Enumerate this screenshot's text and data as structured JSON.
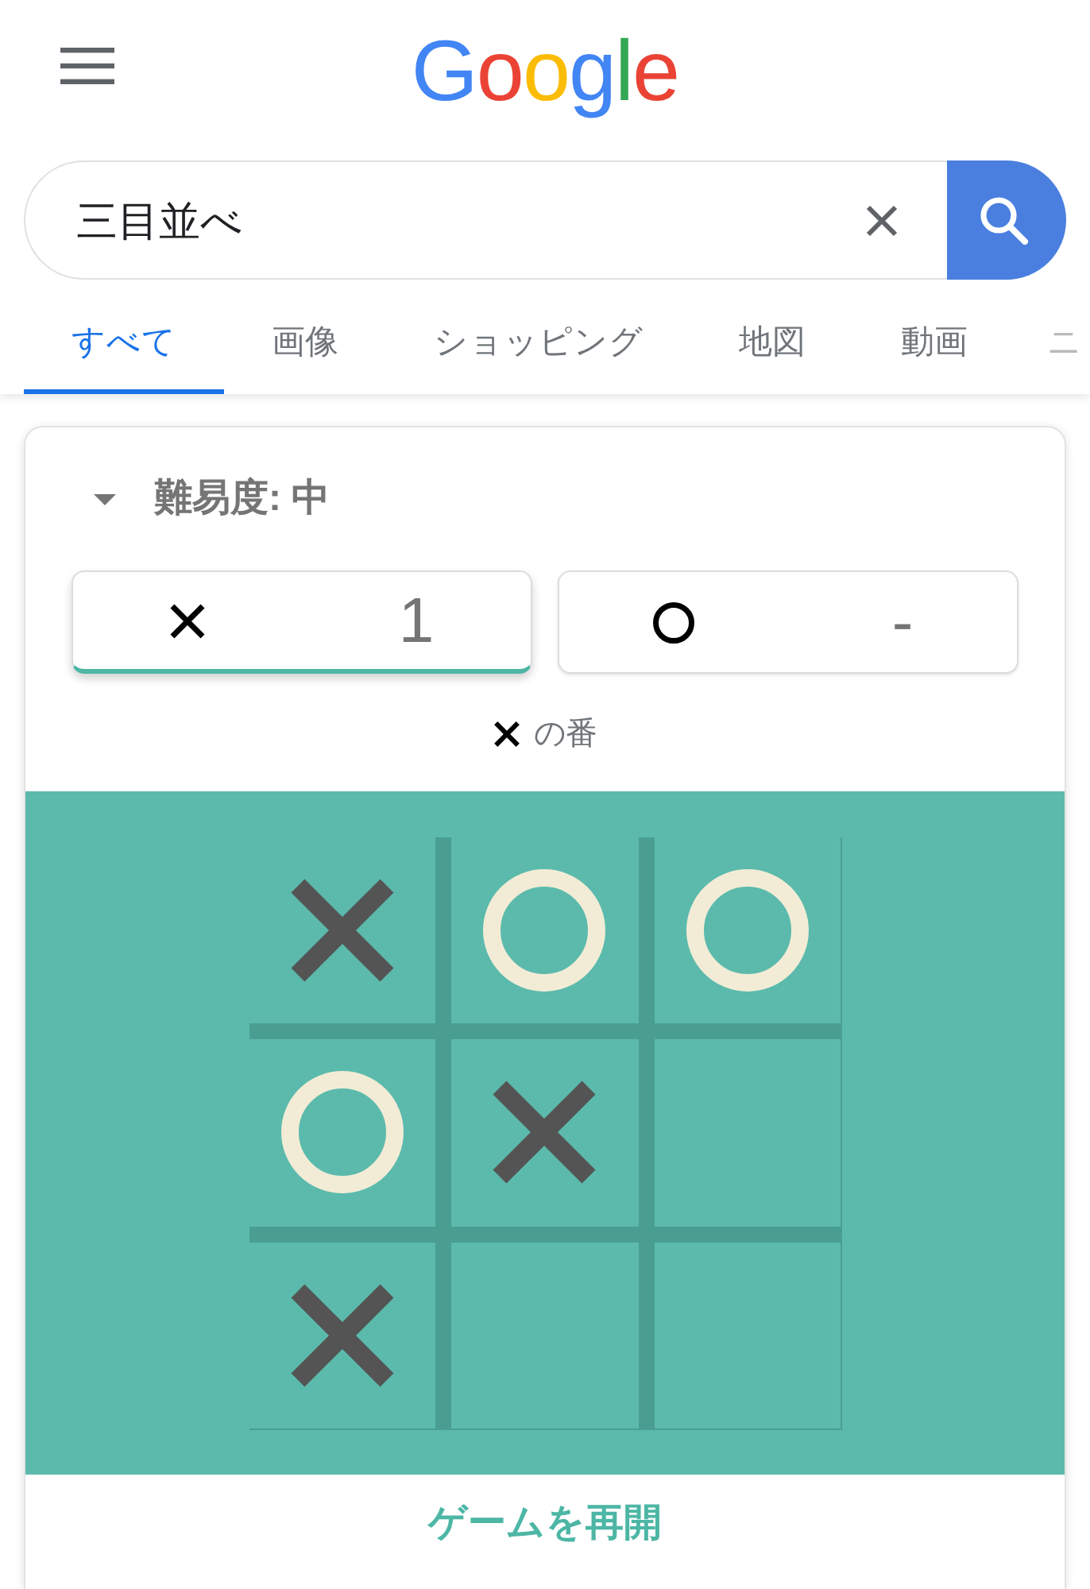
{
  "header": {
    "logo": "Google"
  },
  "search": {
    "value": "三目並べ"
  },
  "tabs": [
    {
      "label": "すべて",
      "selected": true
    },
    {
      "label": "画像",
      "selected": false
    },
    {
      "label": "ショッピング",
      "selected": false
    },
    {
      "label": "地図",
      "selected": false
    },
    {
      "label": "動画",
      "selected": false
    },
    {
      "label": "ニ",
      "selected": false
    }
  ],
  "game": {
    "difficulty": "難易度: 中",
    "players": [
      {
        "kind": "x",
        "score": "1",
        "selected": true
      },
      {
        "kind": "o",
        "score": "-",
        "selected": false
      }
    ],
    "turn": {
      "kind": "x",
      "text": "の番"
    },
    "board": {
      "cells": [
        {
          "kind": "x"
        },
        {
          "kind": "o"
        },
        {
          "kind": "o"
        },
        {
          "kind": "o"
        },
        {
          "kind": "x"
        },
        {
          "kind": "empty"
        },
        {
          "kind": "x"
        },
        {
          "kind": "empty"
        },
        {
          "kind": "empty"
        }
      ]
    },
    "restart_button": "ゲームを再開"
  }
}
